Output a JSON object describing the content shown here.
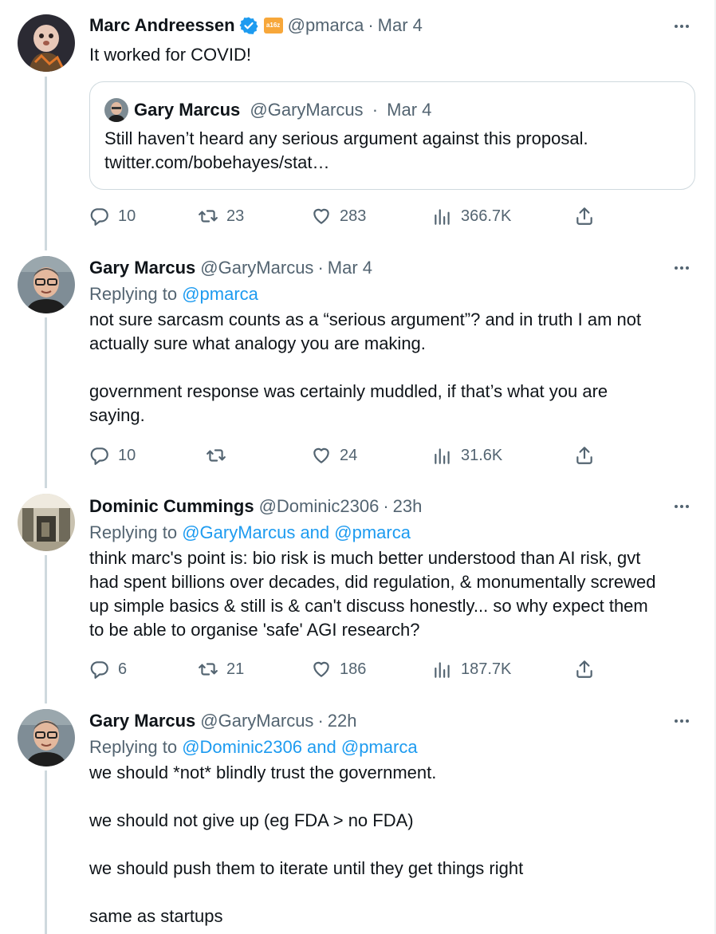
{
  "tweets": [
    {
      "name": "Marc Andreessen",
      "handle": "@pmarca",
      "time": "Mar 4",
      "affiliation_badge": "a16z",
      "text": "It worked for COVID!",
      "quote": {
        "name": "Gary Marcus",
        "handle": "@GaryMarcus",
        "time": "Mar 4",
        "text": "Still haven’t heard any serious argument against this proposal.\ntwitter.com/bobehayes/stat…"
      },
      "stats": {
        "replies": "10",
        "retweets": "23",
        "likes": "283",
        "views": "366.7K"
      }
    },
    {
      "name": "Gary Marcus",
      "handle": "@GaryMarcus",
      "time": "Mar 4",
      "replying_prefix": "Replying to",
      "replying_to": "@pmarca",
      "text": "not sure sarcasm counts as a “serious argument”? and in truth I am not\nactually sure what analogy you are making.\n\ngovernment response was certainly muddled, if that’s what you are\nsaying.",
      "stats": {
        "replies": "10",
        "retweets": "",
        "likes": "24",
        "views": "31.6K"
      }
    },
    {
      "name": "Dominic Cummings",
      "handle": "@Dominic2306",
      "time": "23h",
      "replying_prefix": "Replying to",
      "replying_to": "@GaryMarcus and @pmarca",
      "text": "think marc's point is: bio risk is much better understood than AI risk, gvt\nhad spent billions over decades, did regulation, & monumentally screwed\nup simple basics & still is & can't discuss honestly... so why expect them\nto be able to organise 'safe' AGI research?",
      "stats": {
        "replies": "6",
        "retweets": "21",
        "likes": "186",
        "views": "187.7K"
      }
    },
    {
      "name": "Gary Marcus",
      "handle": "@GaryMarcus",
      "time": "22h",
      "replying_prefix": "Replying to",
      "replying_to": "@Dominic2306 and @pmarca",
      "text": "we should *not* blindly trust the government.\n\nwe should not give up (eg FDA > no FDA)\n\nwe should push them to iterate until they get things right\n\nsame as startups"
    }
  ],
  "dot": "·",
  "colors": {
    "text": "#0f1419",
    "secondary": "#536471",
    "link": "#1d9bf0",
    "border": "#cfd9de"
  },
  "icons": [
    "verified-badge-icon",
    "affiliation-badge-icon",
    "more-icon",
    "reply-icon",
    "retweet-icon",
    "like-icon",
    "views-icon",
    "share-icon"
  ]
}
